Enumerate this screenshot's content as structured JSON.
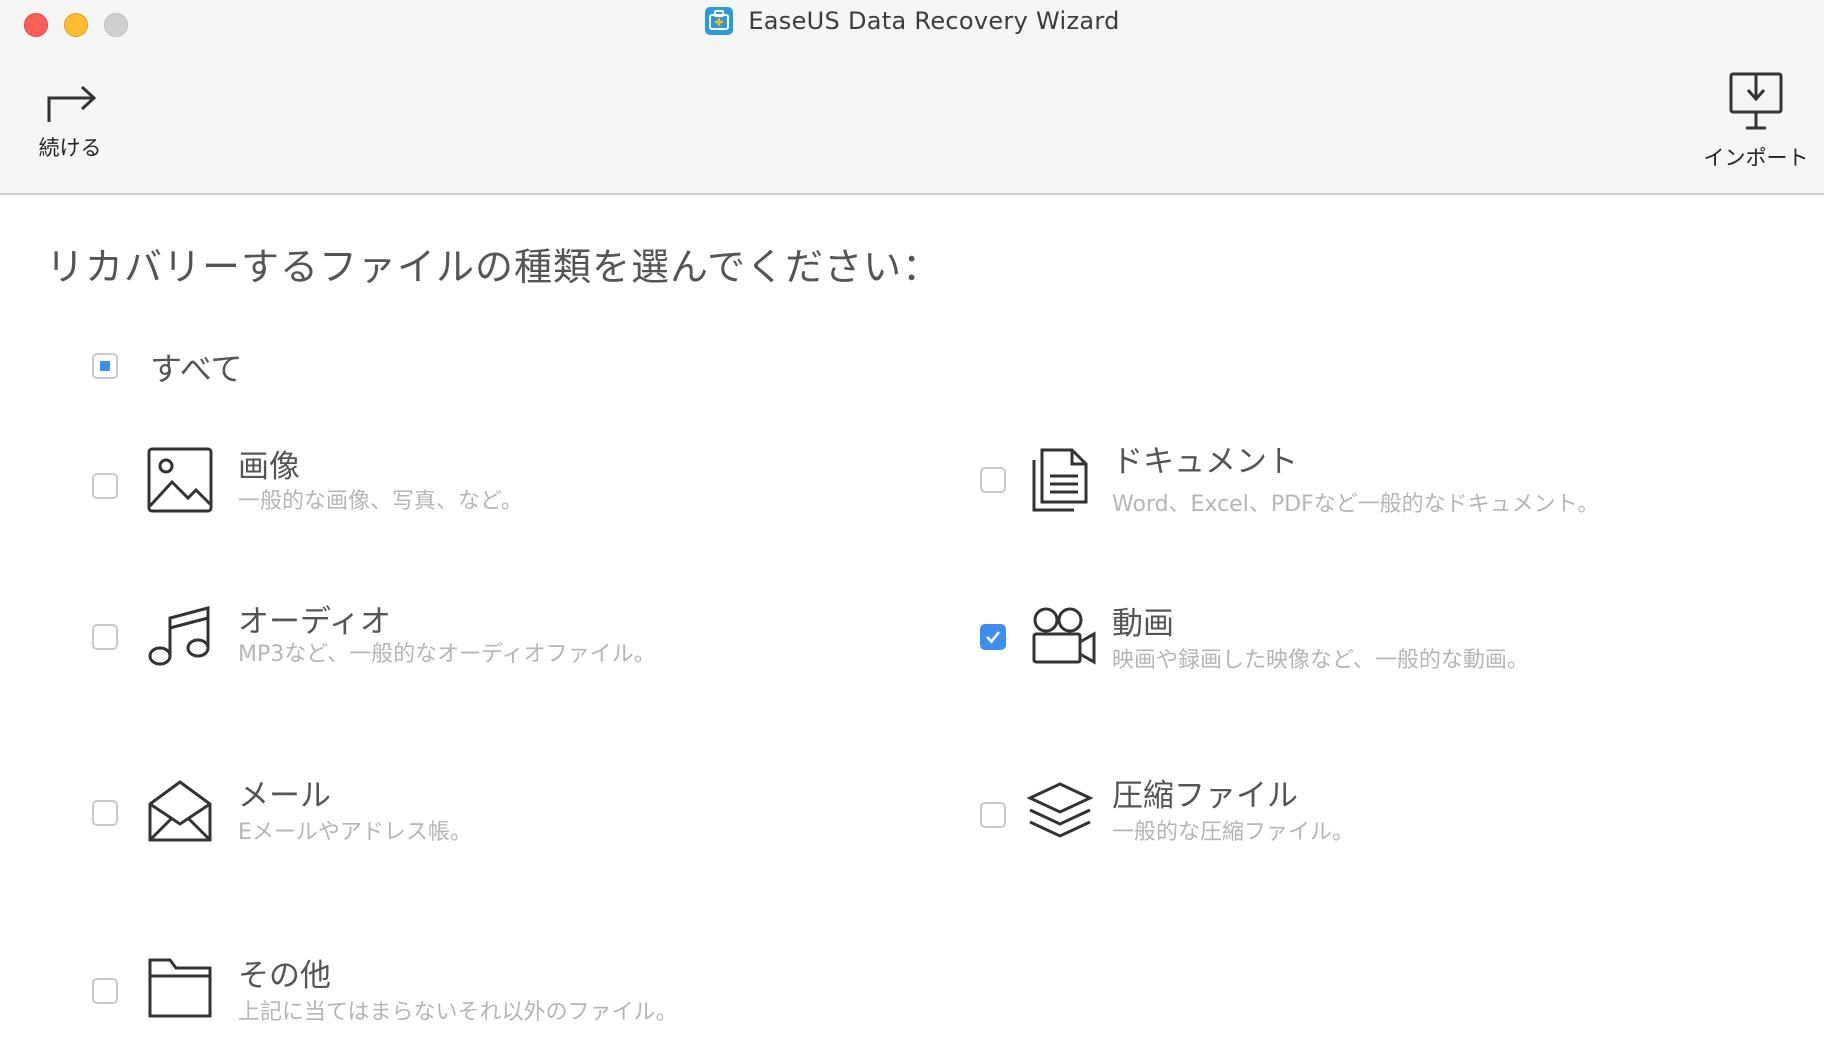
{
  "window": {
    "title": "EaseUS Data Recovery Wizard"
  },
  "toolbar": {
    "continue_label": "続ける",
    "import_label": "インポート"
  },
  "prompt": "リカバリーするファイルの種類を選んでください：",
  "select_all": {
    "label": "すべて",
    "state": "partial"
  },
  "categories": [
    {
      "title": "画像",
      "description": "一般的な画像、写真、など。",
      "icon": "image-icon",
      "checked": false
    },
    {
      "title": "ドキュメント",
      "description": "Word、Excel、PDFなど一般的なドキュメント。",
      "icon": "document-icon",
      "checked": false
    },
    {
      "title": "オーディオ",
      "description": "MP3など、一般的なオーディオファイル。",
      "icon": "music-note-icon",
      "checked": false
    },
    {
      "title": "動画",
      "description": "映画や録画した映像など、一般的な動画。",
      "icon": "video-camera-icon",
      "checked": true
    },
    {
      "title": "メール",
      "description": "Eメールやアドレス帳。",
      "icon": "envelope-icon",
      "checked": false
    },
    {
      "title": "圧縮ファイル",
      "description": "一般的な圧縮ファイル。",
      "icon": "layers-icon",
      "checked": false
    },
    {
      "title": "その他",
      "description": "上記に当てはまらないそれ以外のファイル。",
      "icon": "folder-icon",
      "checked": false
    }
  ],
  "colors": {
    "accent": "#3d8ef0",
    "close": "#fe5f57",
    "minimize": "#febc2e"
  }
}
